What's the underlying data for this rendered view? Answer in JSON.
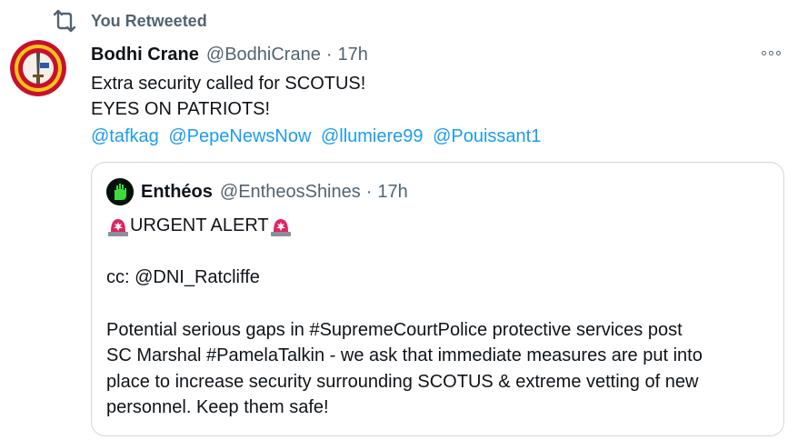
{
  "retweet": {
    "icon": "retweet-icon",
    "label": "You Retweeted"
  },
  "tweet": {
    "author_name": "Bodhi Crane",
    "author_handle": "@BodhiCrane",
    "separator": "·",
    "time": "17h",
    "avatar_icon": "gulf-war-veteran-seal-avatar",
    "lines": [
      "Extra security called for SCOTUS!",
      "EYES ON PATRIOTS!"
    ],
    "mentions": [
      "@tafkag",
      "@PepeNewsNow",
      "@llumiere99",
      "@Pouissant1"
    ],
    "more_icon": "more-options-icon"
  },
  "quote": {
    "author_name": "Enthéos",
    "author_handle": "@EntheosShines",
    "separator": "·",
    "time": "17h",
    "avatar_icon": "green-hand-avatar",
    "alert_text": "URGENT ALERT",
    "alert_icon": "police-siren-emoji",
    "cc_line": "cc: @DNI_Ratcliffe",
    "body_lines": [
      "Potential serious gaps in #SupremeCourtPolice protective services post",
      "SC Marshal #PamelaTalkin - we ask that immediate measures are put into",
      "place to increase security surrounding SCOTUS & extreme vetting of new",
      "personnel.  Keep them safe!"
    ]
  },
  "colors": {
    "text": "#0f1419",
    "secondary": "#536471",
    "link": "#1d9bf0",
    "border": "#cfd9de"
  }
}
